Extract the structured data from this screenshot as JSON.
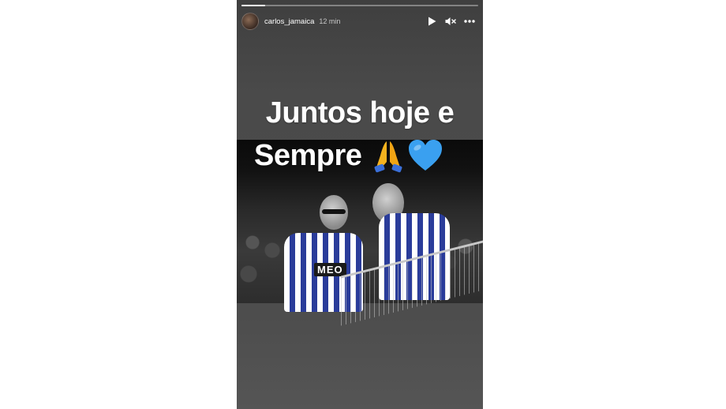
{
  "story": {
    "progress": 0.1,
    "user": {
      "username": "carlos_jamaica",
      "time_ago": "12 min"
    },
    "controls": {
      "play_icon": "play-icon",
      "mute_icon": "volume-muted-icon",
      "more_icon": "more-options-icon"
    },
    "caption": {
      "line1": "Juntos hoje e",
      "line2": "Sempre",
      "emojis": [
        "folded-hands-emoji",
        "blue-heart-emoji"
      ]
    },
    "photo": {
      "sponsor_text": "MEO"
    },
    "colors": {
      "jersey_blue": "#2a3c9a",
      "heart_blue": "#3aa0f0",
      "hands_yellow": "#f5b21e"
    }
  }
}
